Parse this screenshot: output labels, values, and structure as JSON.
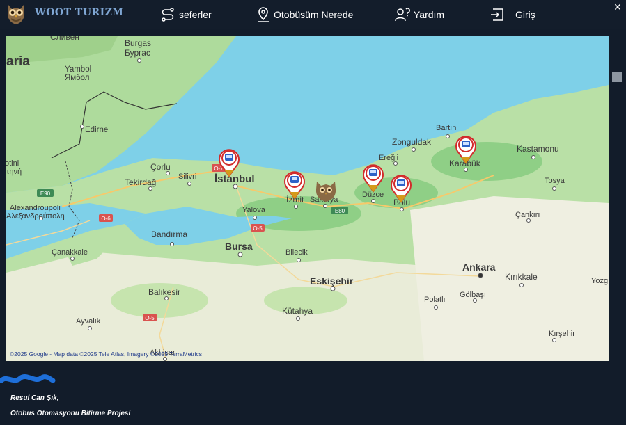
{
  "header": {
    "brand": "WOOT TURIZM",
    "nav": [
      {
        "label": "seferler",
        "icon": "route-icon"
      },
      {
        "label": "Otobüsüm Nerede",
        "icon": "map-pin-icon"
      },
      {
        "label": "Yardım",
        "icon": "help-icon"
      },
      {
        "label": "Giriş",
        "icon": "login-icon"
      }
    ],
    "window_controls": {
      "minimize": "—",
      "close": "✕"
    }
  },
  "map": {
    "attribution": "©2025 Google - Map data ©2025 Tele Atlas, Imagery ©2025 TerraMetrics",
    "markers": [
      "bus-stop-marker",
      "bus-stop-marker",
      "bus-stop-marker",
      "bus-stop-marker",
      "bus-stop-marker"
    ],
    "labels": {
      "slivn": "Сливен",
      "burgas1": "Burgas",
      "burgas2": "Бургас",
      "aria": "aria",
      "yambol1": "Yambol",
      "yambol2": "Ямбол",
      "edirne": "Edirne",
      "otini1": "otini",
      "otini2": "τηνή",
      "corlu": "Çorlu",
      "tekirdag": "Tekirdağ",
      "silivri": "Silivri",
      "istanbul": "İstanbul",
      "izmit": "İzmit",
      "sakarya": "Sakarya",
      "yalova": "Yalova",
      "duzce": "Düzce",
      "eregli": "Ereğli",
      "zonguldak": "Zonguldak",
      "bartin": "Bartın",
      "karabuk": "Karabük",
      "kastamonu": "Kastamonu",
      "tosya": "Tosya",
      "bolu": "Bolu",
      "cankiri": "Çankırı",
      "alex1": "Alexandroupoli",
      "alex2": "Αλεξανδρούπολη",
      "bandirma": "Bandırma",
      "bursa": "Bursa",
      "bilecik": "Bilecik",
      "canakkale": "Çanakkale",
      "eskisehir": "Eskişehir",
      "ankara": "Ankara",
      "kirikkale": "Kırıkkale",
      "balikesir": "Balıkesir",
      "kutahya": "Kütahya",
      "polatli": "Polatlı",
      "golbasi": "Gölbaşı",
      "ayvalik": "Ayvalık",
      "akhisar": "Akhisar",
      "kirsehir": "Kırşehir",
      "yozg": "Yozg",
      "e90": "E90",
      "e80": "E80",
      "o7": "O-7",
      "o6": "O-6",
      "o5": "O-5",
      "o5b": "O-5"
    }
  },
  "footer": {
    "author": "Resul Can Şık,",
    "project": "Otobus Otomasyonu Bitirme Projesi"
  },
  "colors": {
    "background": "#121c2a",
    "brand": "#7fa6d3",
    "sea": "#7ed0e8",
    "land": "#aedb9c",
    "marker": "#d22b2b",
    "marker_tip": "#d49a1a"
  }
}
